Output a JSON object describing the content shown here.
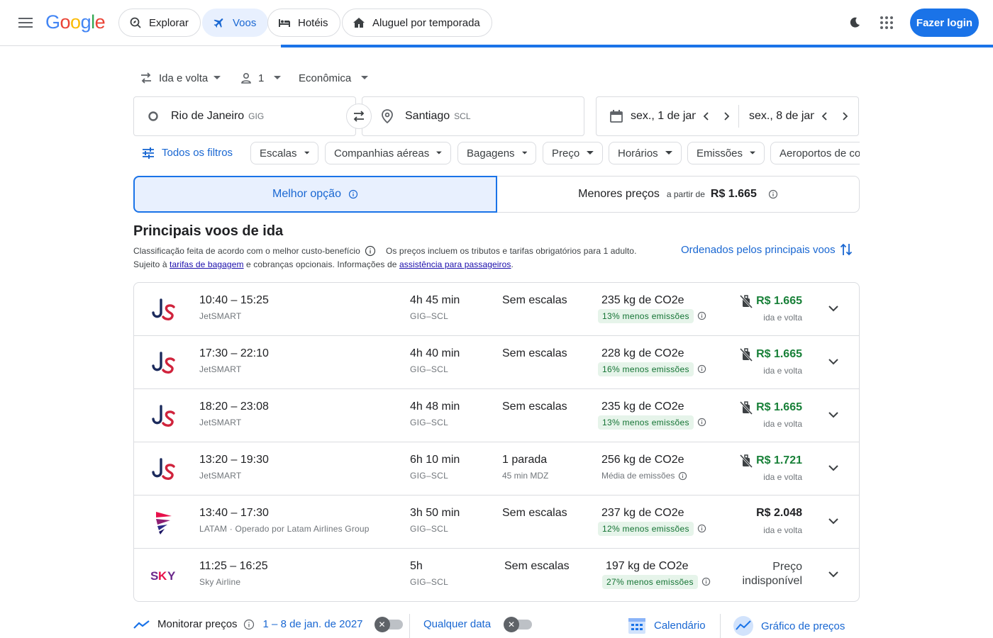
{
  "header": {
    "logo_letters": [
      "G",
      "o",
      "o",
      "g",
      "l",
      "e"
    ],
    "logo_colors": [
      "#4285f4",
      "#ea4335",
      "#fbbc05",
      "#4285f4",
      "#34a853",
      "#ea4335"
    ],
    "nav": [
      {
        "label": "Explorar",
        "icon": "explore-icon"
      },
      {
        "label": "Voos",
        "icon": "flight-icon",
        "active": true
      },
      {
        "label": "Hotéis",
        "icon": "hotel-bed-icon"
      },
      {
        "label": "Aluguel por temporada",
        "icon": "house-icon"
      }
    ],
    "login_label": "Fazer login"
  },
  "search": {
    "trip_type": "Ida e volta",
    "passengers": "1",
    "cabin_class": "Econômica",
    "origin": {
      "city": "Rio de Janeiro",
      "code": "GIG"
    },
    "destination": {
      "city": "Santiago",
      "code": "SCL"
    },
    "depart_date": "sex., 1 de jan",
    "return_date": "sex., 8 de jan"
  },
  "filters": {
    "all_filters_label": "Todos os filtros",
    "chips": [
      "Escalas",
      "Companhias aéreas",
      "Bagagens",
      "Preço",
      "Horários",
      "Emissões",
      "Aeroportos de co"
    ]
  },
  "tabs": {
    "best": "Melhor opção",
    "cheapest": "Menores preços",
    "cheapest_from": "a partir de",
    "cheapest_price": "R$ 1.665"
  },
  "results_header": {
    "title": "Principais voos de ida",
    "ranking_note": "Classificação feita de acordo com o melhor custo-benefício",
    "price_note": "Os preços incluem os tributos e tarifas obrigatórios para 1 adulto.",
    "subject_prefix": "Sujeito à",
    "baggage_link": "tarifas de bagagem",
    "subject_middle": "e cobranças opcionais. Informações de",
    "assistance_link": "assistência para passageiros",
    "subject_suffix": ".",
    "sort_label": "Ordenados pelos principais voos"
  },
  "flights": [
    {
      "airline_logo": "jetsmart-logo",
      "times": "10:40 – 15:25",
      "airline": "JetSMART",
      "duration": "4h 45 min",
      "route": "GIG–SCL",
      "stops": "Sem escalas",
      "stop_detail": "",
      "co2": "235 kg de CO2e",
      "emissions": "13% menos emissões",
      "emissions_low": true,
      "price": "R$ 1.665",
      "price_green": true,
      "no_bag": true,
      "price_sub": "ida e volta"
    },
    {
      "airline_logo": "jetsmart-logo",
      "times": "17:30 – 22:10",
      "airline": "JetSMART",
      "duration": "4h 40 min",
      "route": "GIG–SCL",
      "stops": "Sem escalas",
      "stop_detail": "",
      "co2": "228 kg de CO2e",
      "emissions": "16% menos emissões",
      "emissions_low": true,
      "price": "R$ 1.665",
      "price_green": true,
      "no_bag": true,
      "price_sub": "ida e volta"
    },
    {
      "airline_logo": "jetsmart-logo",
      "times": "18:20 – 23:08",
      "airline": "JetSMART",
      "duration": "4h 48 min",
      "route": "GIG–SCL",
      "stops": "Sem escalas",
      "stop_detail": "",
      "co2": "235 kg de CO2e",
      "emissions": "13% menos emissões",
      "emissions_low": true,
      "price": "R$ 1.665",
      "price_green": true,
      "no_bag": true,
      "price_sub": "ida e volta"
    },
    {
      "airline_logo": "jetsmart-logo",
      "times": "13:20 – 19:30",
      "airline": "JetSMART",
      "duration": "6h 10 min",
      "route": "GIG–SCL",
      "stops": "1 parada",
      "stop_detail": "45 min MDZ",
      "co2": "256 kg de CO2e",
      "emissions": "Média de emissões",
      "emissions_low": false,
      "price": "R$ 1.721",
      "price_green": true,
      "no_bag": true,
      "price_sub": "ida e volta"
    },
    {
      "airline_logo": "latam-logo",
      "times": "13:40 – 17:30",
      "airline": "LATAM · Operado por Latam Airlines Group",
      "duration": "3h 50 min",
      "route": "GIG–SCL",
      "stops": "Sem escalas",
      "stop_detail": "",
      "co2": "237 kg de CO2e",
      "emissions": "12% menos emissões",
      "emissions_low": true,
      "price": "R$ 2.048",
      "price_green": false,
      "no_bag": false,
      "price_sub": "ida e volta"
    },
    {
      "airline_logo": "sky-logo",
      "times": "11:25 – 16:25",
      "airline": "Sky Airline",
      "duration": "5h",
      "route": "GIG–SCL",
      "stops": "Sem escalas",
      "stop_detail": "",
      "co2": "197 kg de CO2e",
      "emissions": "27% menos emissões",
      "emissions_low": true,
      "price": "",
      "price_green": false,
      "no_bag": false,
      "price_sub": "",
      "unavailable": "Preço indisponível"
    }
  ],
  "footer": {
    "track_prices": "Monitorar preços",
    "track_dates": "1 – 8 de jan. de 2027",
    "any_date": "Qualquer data",
    "calendar": "Calendário",
    "price_graph": "Gráfico de preços",
    "toggle_symbol": "✕"
  },
  "colors": {
    "accent": "#1a73e8",
    "green": "#188038",
    "jetsmart_blue": "#1b2a5c",
    "jetsmart_red": "#d0233c",
    "sky_purple": "#6b2a8c"
  }
}
